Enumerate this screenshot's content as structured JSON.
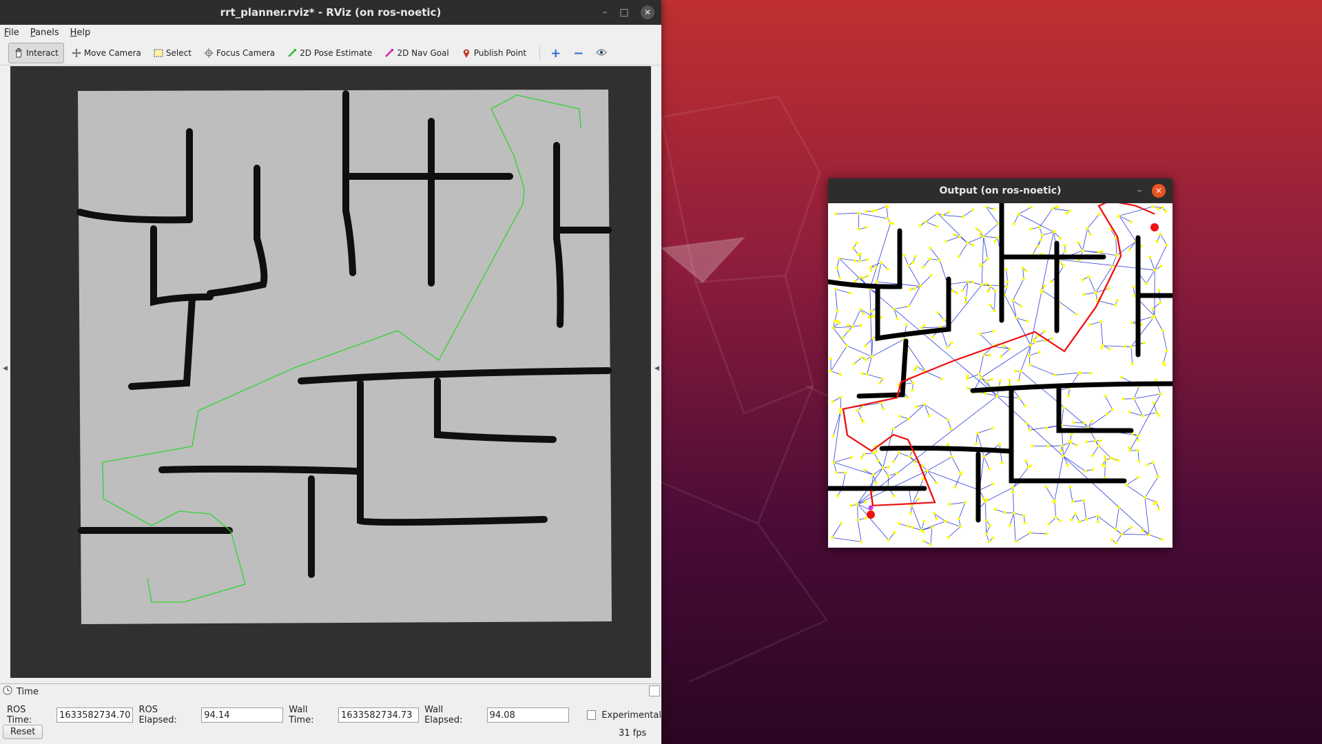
{
  "rviz": {
    "title": "rrt_planner.rviz* - RViz (on ros-noetic)",
    "menus": [
      "File",
      "Panels",
      "Help"
    ],
    "toolbar": {
      "interact": "Interact",
      "move_camera": "Move Camera",
      "select": "Select",
      "focus_camera": "Focus Camera",
      "pose_estimate": "2D Pose Estimate",
      "nav_goal": "2D Nav Goal",
      "publish_point": "Publish Point"
    },
    "time_panel": {
      "title": "Time",
      "ros_time_label": "ROS Time:",
      "ros_time": "1633582734.70",
      "ros_elapsed_label": "ROS Elapsed:",
      "ros_elapsed": "94.14",
      "wall_time_label": "Wall Time:",
      "wall_time": "1633582734.73",
      "wall_elapsed_label": "Wall Elapsed:",
      "wall_elapsed": "94.08",
      "experimental": "Experimental",
      "reset": "Reset",
      "fps": "31 fps"
    }
  },
  "output": {
    "title": "Output (on ros-noetic)"
  },
  "colors": {
    "map_free": "#bebebe",
    "wall": "#0f0f0f",
    "rviz_path": "#2fd42f",
    "rrt_path": "#ee1111",
    "tree_edge": "#2a3bd6",
    "tree_node": "#ffff00",
    "wallpaper_top": "#c2342c",
    "wallpaper_bottom": "#2c0623"
  }
}
